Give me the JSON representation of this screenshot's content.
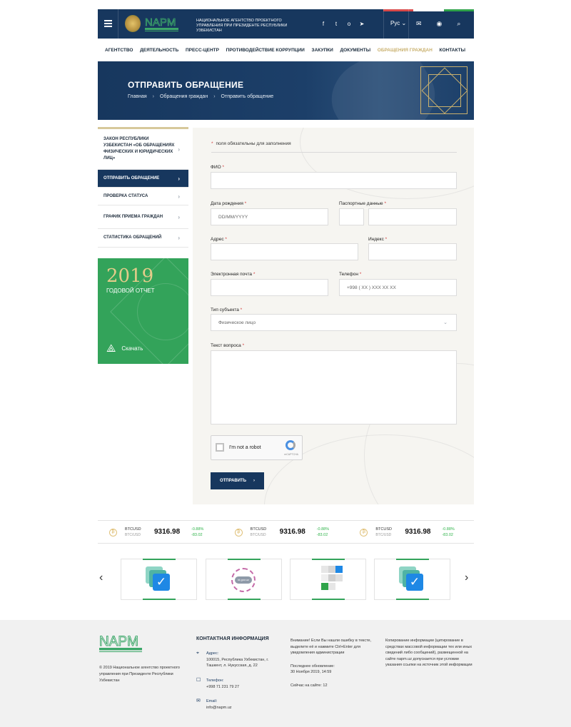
{
  "header": {
    "org_name": "Национальное агентство проектного управления при Президенте Республики Узбекистан",
    "lang": "Рус",
    "socials": [
      "facebook-icon",
      "twitter-icon",
      "ok-icon",
      "telegram-icon"
    ],
    "flag_colors": [
      "#d94a4a",
      "#ffffff",
      "#2fa34a"
    ]
  },
  "nav": {
    "items": [
      "Агентство",
      "Деятельность",
      "Пресс-центр",
      "Противодействие коррупции",
      "Закупки",
      "Документы",
      "Обращения граждан",
      "Контакты"
    ],
    "active": "Обращения граждан"
  },
  "hero": {
    "title": "Отправить обращение",
    "breadcrumbs": [
      "Главная",
      "Обращения граждан",
      "Отправить обращение"
    ]
  },
  "sidebar": {
    "items": [
      {
        "label": "Закон Республики Узбекистан «Об обращениях физических и юридических лиц»"
      },
      {
        "label": "Отправить обращение"
      },
      {
        "label": "Проверка статуса"
      },
      {
        "label": "График приема граждан"
      },
      {
        "label": "Статистика обращений"
      }
    ],
    "active_index": 1
  },
  "report": {
    "year": "2019",
    "subtitle": "Годовой отчет",
    "download": "Скачать"
  },
  "form": {
    "required_note": "поля обязательны для заполнения",
    "fio_label": "ФИО",
    "birth_label": "Дата рождения",
    "birth_placeholder": "DD/MM/YYYY",
    "passport_label": "Паспортные данные",
    "address_label": "Адрес",
    "index_label": "Индекс",
    "email_label": "Электронная почта",
    "phone_label": "Телефон",
    "phone_placeholder": "+998 ( XX ) XXX XX XX",
    "subject_label": "Тип субъекта",
    "subject_value": "Физическое лицо",
    "question_label": "Текст вопроса",
    "captcha_text": "I'm not a robot",
    "captcha_brand": "reCAPTCHA",
    "submit": "Отправить"
  },
  "ticker": [
    {
      "pair": "BTCUSD",
      "sub": "BTC/USD",
      "price": "9316.98",
      "pct": "-0.88%",
      "delta": "-83.02"
    },
    {
      "pair": "BTCUSD",
      "sub": "BTC/USD",
      "price": "9316.98",
      "pct": "-0.88%",
      "delta": "-83.02"
    },
    {
      "pair": "BTCUSD",
      "sub": "BTC/USD",
      "price": "9316.98",
      "pct": "-0.88%",
      "delta": "-83.02"
    }
  ],
  "carousel": {
    "id_gov_label": "id.gov.uz"
  },
  "footer": {
    "copyright": "© 2019 Национальное агентство проектного управления при Президенте Республики Узбекистан",
    "contact_title": "Контактная информация",
    "address_key": "Адрес:",
    "address_val": "100015, Республика Узбекистан, г. Ташкент, л. Нукусская, д. 22",
    "phone_key": "Телефон:",
    "phone_val": "+998 71 231 79 27",
    "email_key": "Email:",
    "email_val": "info@napm.uz",
    "error_note": "Внимание! Если Вы нашли ошибку в тексте, выделите её и нажмите Ctrl+Enter для уведомления администрации",
    "updated_label": "Последнее обновление:",
    "updated_val": "30 Ноября 2019, 14:59",
    "online": "Сейчас на сайте: 12",
    "copy_note": "Копирование информации (цитирование в средствах массовой информации тех или иных сведений либо сообщений), размещенной на сайте napm.uz допускается при условии указания ссылки на источник этой информации"
  },
  "colors": {
    "primary": "#17375e",
    "gold": "#c9b06d",
    "green": "#33a35a",
    "required": "#d23b3b"
  }
}
